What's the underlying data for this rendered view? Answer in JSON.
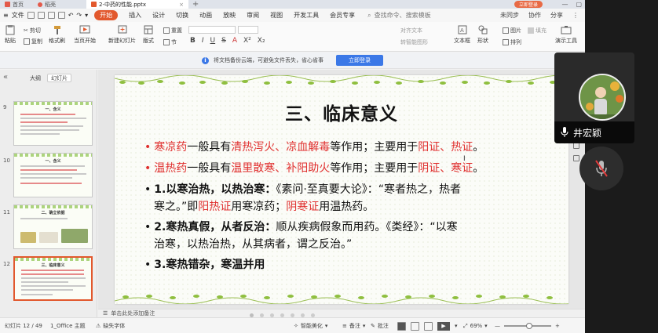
{
  "tabs": {
    "home": "首页",
    "doc1": "稻壳",
    "doc2": "2-中药的性能.pptx",
    "new": "+",
    "badge": "立即登录"
  },
  "menubar": {
    "file": "文件",
    "items": [
      "开始",
      "插入",
      "设计",
      "切换",
      "动画",
      "放映",
      "审阅",
      "视图",
      "开发工具",
      "会员专享"
    ],
    "search": "查找命令、搜索模板",
    "right": [
      "未同步",
      "协作",
      "分享"
    ]
  },
  "ribbon": {
    "paste": "粘贴",
    "cut": "剪切",
    "copy": "复制",
    "format": "格式刷",
    "from_current": "当页开始",
    "new_slide": "新建幻灯片",
    "layout": "版式",
    "section": "节",
    "reset": "重置",
    "letters": [
      "B",
      "I",
      "U",
      "S",
      "A",
      "X²",
      "X₂"
    ],
    "textbox": "文本框",
    "shape": "形状",
    "arrange": "排列",
    "present": "演示工具",
    "picture": "图片",
    "fill": "填充",
    "align_text": "对齐文本",
    "smart": "转智能图形"
  },
  "infobar": {
    "message": "将文档备份云端，可避免文件丢失，省心省事",
    "button": "立即登录"
  },
  "leftpanel": {
    "tab_outline": "大纲",
    "tab_slides": "幻灯片",
    "thumbs": [
      {
        "num": "9",
        "title": "一、含义"
      },
      {
        "num": "10",
        "title": "一、含义"
      },
      {
        "num": "11",
        "title": "二、确立依据"
      },
      {
        "num": "12",
        "title": "三、临床意义"
      }
    ]
  },
  "slide": {
    "title": "三、临床意义",
    "l1": {
      "bullet": "•",
      "a": "寒凉药",
      "b": "一般具有",
      "c": "清热泻火、凉血解毒",
      "d": "等作用；主要用于",
      "e": "阳证、热证",
      "f": "。"
    },
    "l2": {
      "bullet": "•",
      "a": "温热药",
      "b": "一般具有",
      "c": "温里散寒、补阳助火",
      "d": "等作用；主要用于",
      "e": "阴证、寒证",
      "f": "。"
    },
    "l3a": {
      "bullet": "•",
      "bold": "1.以寒治热，以热治寒：",
      "rest": "《素问·至真要大论》：“寒者热之，热者"
    },
    "l3b": {
      "a": "寒之。”即",
      "b": "阳热证",
      "c": "用寒凉药；",
      "d": "阴寒证",
      "e": "用温热药。"
    },
    "l4a": {
      "bullet": "•",
      "bold": "2.寒热真假，从者反治：",
      "rest": "顺从疾病假象而用药。《类经》：“以寒"
    },
    "l4b": {
      "a": "治寒，以热治热，从其病者，谓之反治。”"
    },
    "l5": {
      "bullet": "•",
      "bold": "3.寒热错杂，寒温并用"
    }
  },
  "notes": {
    "text": "单击此处添加备注"
  },
  "statusbar": {
    "slide_count": "幻灯片 12 / 49",
    "theme": "1_Office 主题",
    "missing_font": "缺失字体",
    "beautify": "智能美化",
    "notes": "备注",
    "comments": "批注",
    "zoom": "69%"
  },
  "video": {
    "name": "井宏颖"
  }
}
